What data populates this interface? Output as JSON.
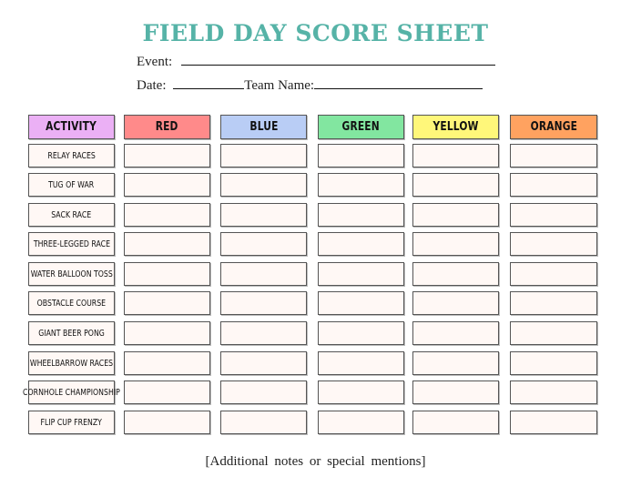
{
  "title": "FIELD DAY SCORE SHEET",
  "fields": {
    "event_label": "Event:",
    "date_label": "Date:",
    "team_label": "Team  Name:"
  },
  "headers": {
    "activity": "ACTIVITY",
    "teams": [
      {
        "label": "RED",
        "color": "#ff8a8a"
      },
      {
        "label": "BLUE",
        "color": "#b9cdf5"
      },
      {
        "label": "GREEN",
        "color": "#82e6a0"
      },
      {
        "label": "YELLOW",
        "color": "#fff77a"
      },
      {
        "label": "ORANGE",
        "color": "#ffa260"
      }
    ],
    "activity_color": "#ebb0f5"
  },
  "activities": [
    "RELAY RACES",
    "TUG OF WAR",
    "SACK RACE",
    "THREE-LEGGED RACE",
    "WATER BALLOON TOSS",
    "OBSTACLE COURSE",
    "GIANT BEER PONG",
    "WHEELBARROW RACES",
    "CORNHOLE CHAMPIONSHIP",
    "FLIP CUP FRENZY"
  ],
  "notes": "[Additional notes or special mentions]"
}
